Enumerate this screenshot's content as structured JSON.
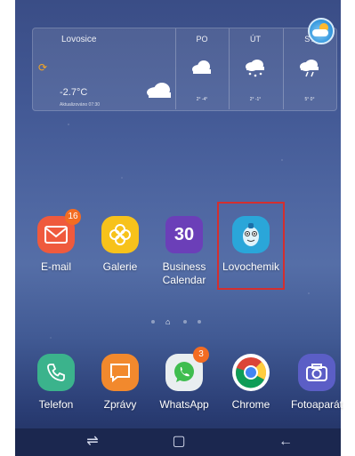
{
  "weather": {
    "city": "Lovosice",
    "temperature": "-2.7°C",
    "updated": "Aktualizováno 07:30",
    "days": [
      {
        "label": "PO",
        "range": "2° -4°",
        "icon": "cloud-icon"
      },
      {
        "label": "ÚT",
        "range": "2° -1°",
        "icon": "snow-cloud-icon"
      },
      {
        "label": "ST",
        "range": "5° 0°",
        "icon": "rain-cloud-icon"
      }
    ]
  },
  "apps": [
    {
      "label": "E-mail",
      "badge": "16",
      "icon": "mail-icon",
      "color": "#ef5a3d"
    },
    {
      "label": "Galerie",
      "icon": "flower-icon",
      "color": "#f7c21b"
    },
    {
      "label": "Business\nCalendar",
      "icon": "calendar-icon",
      "color": "#6b3fb8",
      "date": "30"
    },
    {
      "label": "Lovochemik",
      "icon": "mascot-icon",
      "color": "#2aa6d9"
    }
  ],
  "dock": [
    {
      "label": "Telefon",
      "icon": "phone-icon",
      "color": "#3bb38c"
    },
    {
      "label": "Zprávy",
      "icon": "message-icon",
      "color": "#f2892d"
    },
    {
      "label": "WhatsApp",
      "badge": "3",
      "icon": "whatsapp-icon",
      "color": "#e9eef0"
    },
    {
      "label": "Chrome",
      "icon": "chrome-icon",
      "color": "#ffffff"
    },
    {
      "label": "Fotoaparát",
      "icon": "camera-icon",
      "color": "#5b5ec6"
    }
  ]
}
